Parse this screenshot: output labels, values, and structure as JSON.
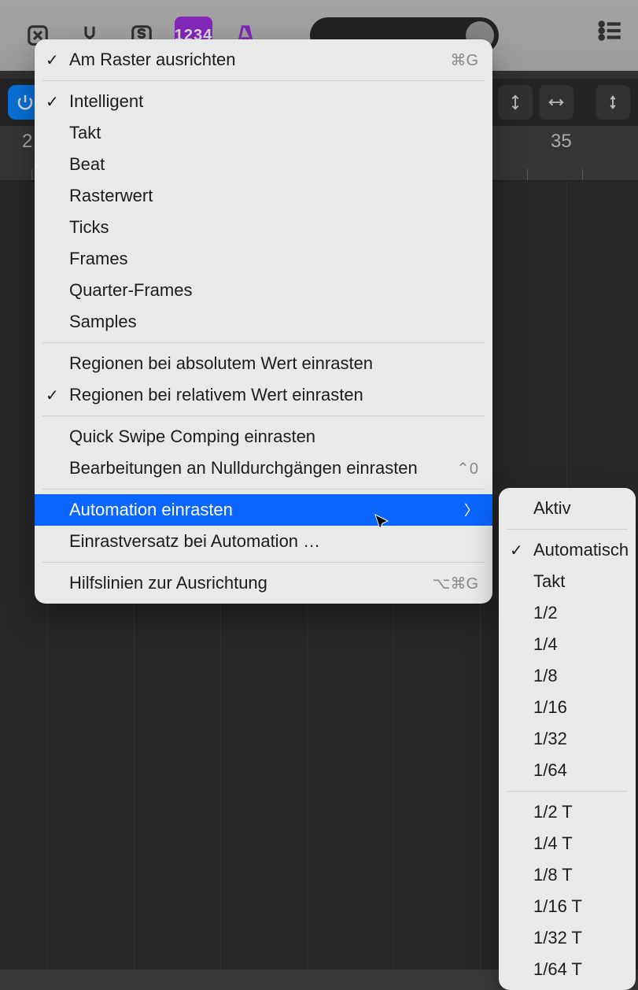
{
  "toolbar": {
    "badge_text": "1234"
  },
  "ruler": {
    "left_number": "2",
    "right_number": "35"
  },
  "menu": {
    "snap_to_grid": {
      "label": "Am Raster ausrichten",
      "shortcut": "⌘G",
      "checked": true
    },
    "modes": [
      {
        "label": "Intelligent",
        "checked": true
      },
      {
        "label": "Takt"
      },
      {
        "label": "Beat"
      },
      {
        "label": "Rasterwert"
      },
      {
        "label": "Ticks"
      },
      {
        "label": "Frames"
      },
      {
        "label": "Quarter-Frames"
      },
      {
        "label": "Samples"
      }
    ],
    "region_abs": {
      "label": "Regionen bei absolutem Wert einrasten"
    },
    "region_rel": {
      "label": "Regionen bei relativem Wert einrasten",
      "checked": true
    },
    "quick_swipe": {
      "label": "Quick Swipe Comping einrasten"
    },
    "zero_cross": {
      "label": "Bearbeitungen an Nulldurchgängen einrasten",
      "shortcut": "⌃0"
    },
    "automation": {
      "label": "Automation einrasten"
    },
    "automation_offset": {
      "label": "Einrastversatz bei Automation …"
    },
    "guides": {
      "label": "Hilfslinien zur Ausrichtung",
      "shortcut": "⌥⌘G"
    }
  },
  "submenu": {
    "active": {
      "label": "Aktiv"
    },
    "group1": [
      {
        "label": "Automatisch",
        "checked": true
      },
      {
        "label": "Takt"
      },
      {
        "label": "1/2"
      },
      {
        "label": "1/4"
      },
      {
        "label": "1/8"
      },
      {
        "label": "1/16"
      },
      {
        "label": "1/32"
      },
      {
        "label": "1/64"
      }
    ],
    "group2": [
      {
        "label": "1/2 T"
      },
      {
        "label": "1/4 T"
      },
      {
        "label": "1/8 T"
      },
      {
        "label": "1/16 T"
      },
      {
        "label": "1/32 T"
      },
      {
        "label": "1/64 T"
      }
    ]
  }
}
